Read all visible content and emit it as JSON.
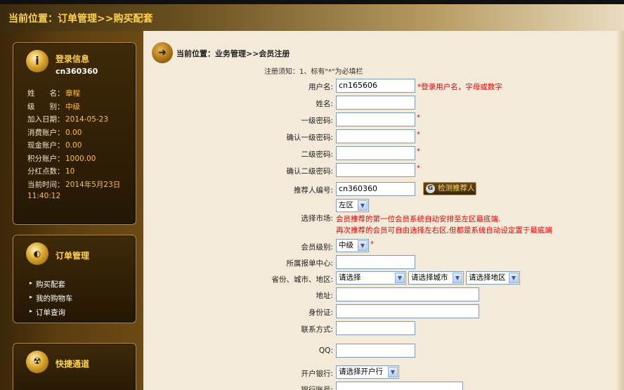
{
  "page": {
    "breadcrumb": "当前位置：订单管理>>购买配套"
  },
  "login_panel": {
    "title": "登录信息",
    "username": "cn360360",
    "rows": [
      {
        "k": "姓　　名：",
        "v": "章程"
      },
      {
        "k": "级　　别：",
        "v": "中级"
      },
      {
        "k": "加入日期：",
        "v": "2014-05-23"
      },
      {
        "k": "消费账户：",
        "v": "0.00"
      },
      {
        "k": "现金账户：",
        "v": "0.00"
      },
      {
        "k": "积分账户：",
        "v": "1000.00"
      },
      {
        "k": "分红点数：",
        "v": "10"
      },
      {
        "k": "当前时间：",
        "v": "2014年5月23日"
      }
    ],
    "time_line2": "11:40:12"
  },
  "order_panel": {
    "title": "订单管理",
    "items": [
      "购买配套",
      "我的购物车",
      "订单查询"
    ]
  },
  "quick_panel": {
    "title": "快捷通道"
  },
  "main": {
    "breadcrumb": "当前位置：业务管理>>会员注册",
    "notice": "注册须知：1、标有\"*\"为必填栏",
    "fields": {
      "username": {
        "label": "用户名:",
        "value": "cn165606",
        "hint": "*登录用户名，字母或数字"
      },
      "name": {
        "label": "姓名:",
        "value": ""
      },
      "pwd1": {
        "label": "一级密码:",
        "value": "",
        "star": "*"
      },
      "pwd1_confirm": {
        "label": "确认一级密码:",
        "value": "",
        "star": "*"
      },
      "pwd2": {
        "label": "二级密码:",
        "value": "",
        "star": "*"
      },
      "pwd2_confirm": {
        "label": "确认二级密码:",
        "value": "",
        "star": "*"
      },
      "referrer": {
        "label": "推荐人编号:",
        "value": "cn360360",
        "button": "检测推荐人"
      },
      "market": {
        "label": "选择市场:",
        "value": "左区",
        "hint1": "会员推荐的第一位会员系统自动安排至左区最底端.",
        "hint2": "再次推荐的会员可自由选择左右区,但都是系统自动设定置于最底端"
      },
      "level": {
        "label": "会员级别:",
        "value": "中级",
        "star": "*"
      },
      "center": {
        "label": "所属报单中心:",
        "value": ""
      },
      "region": {
        "label": "省份、城市、地区:",
        "province": "请选择",
        "city": "请选择城市",
        "district": "请选择地区"
      },
      "address": {
        "label": "地址:",
        "value": ""
      },
      "id_card": {
        "label": "身份证:",
        "value": ""
      },
      "contact": {
        "label": "联系方式:",
        "value": ""
      },
      "qq": {
        "label": "QQ:",
        "value": ""
      },
      "bank": {
        "label": "开户银行:",
        "value": "请选择开户行"
      },
      "bank_account": {
        "label": "银行账号:",
        "value": ""
      }
    }
  }
}
